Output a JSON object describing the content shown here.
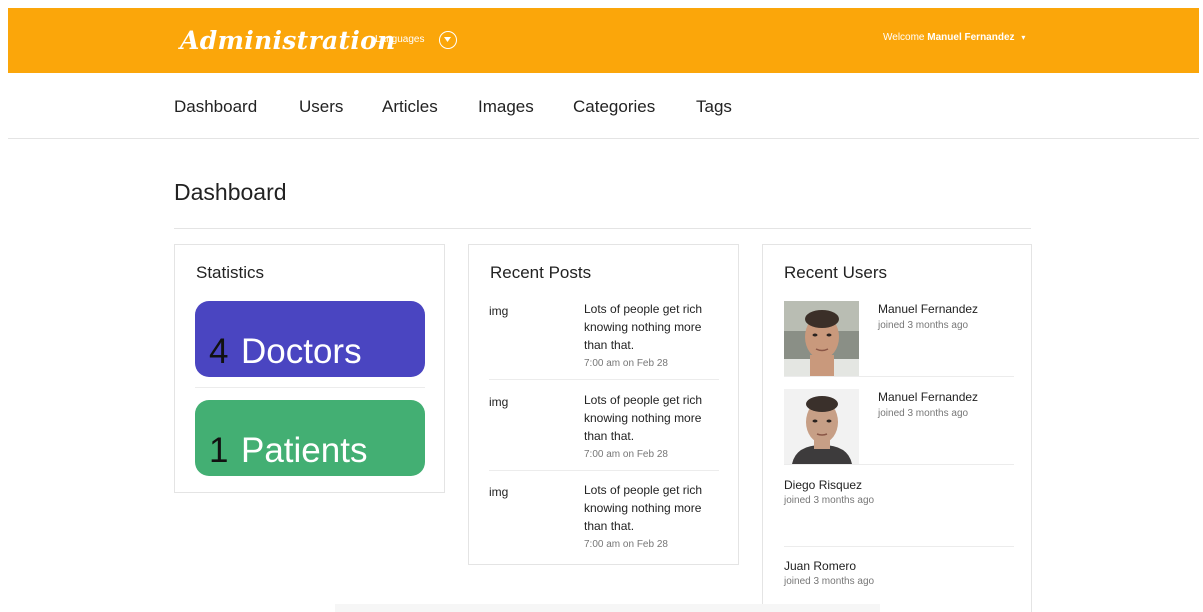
{
  "header": {
    "brand": "Administration",
    "languages_label": "Languages",
    "welcome_prefix": "Welcome",
    "user_name": "Manuel Fernandez",
    "dropdown_icon": "caret-down-icon",
    "colors": {
      "bar": "#fba60a",
      "text": "#ffffff"
    }
  },
  "nav": {
    "items": [
      "Dashboard",
      "Users",
      "Articles",
      "Images",
      "Categories",
      "Tags"
    ]
  },
  "page": {
    "title": "Dashboard"
  },
  "statistics": {
    "title": "Statistics",
    "cards": [
      {
        "count": "4",
        "label": "Doctors",
        "color": "#4a45c1"
      },
      {
        "count": "1",
        "label": "Patients",
        "color": "#43af73"
      }
    ]
  },
  "recent_posts": {
    "title": "Recent Posts",
    "items": [
      {
        "image_alt": "img",
        "text": "Lots of people get rich knowing nothing more than that.",
        "time": "7:00 am on Feb 28"
      },
      {
        "image_alt": "img",
        "text": "Lots of people get rich knowing nothing more than that.",
        "time": "7:00 am on Feb 28"
      },
      {
        "image_alt": "img",
        "text": "Lots of people get rich knowing nothing more than that.",
        "time": "7:00 am on Feb 28"
      }
    ]
  },
  "recent_users": {
    "title": "Recent Users",
    "items": [
      {
        "name": "Manuel Fernandez",
        "joined": "joined 3 months ago",
        "has_photo": true
      },
      {
        "name": "Manuel Fernandez",
        "joined": "joined 3 months ago",
        "has_photo": true
      },
      {
        "name": "Diego Risquez",
        "joined": "joined 3 months ago",
        "has_photo": false
      },
      {
        "name": "Juan Romero",
        "joined": "joined 3 months ago",
        "has_photo": false
      }
    ]
  }
}
